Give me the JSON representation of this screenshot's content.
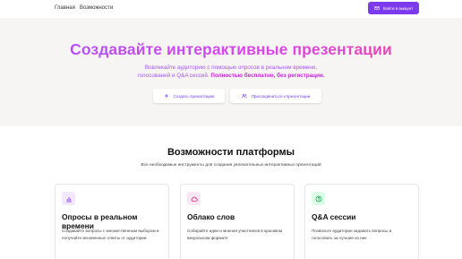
{
  "nav": {
    "home": "Главная",
    "features": "Возможности",
    "login": "Войти в аккаунт"
  },
  "hero": {
    "title": "Создавайте интерактивные презентации",
    "subtitle_line1": "Вовлекайте аудиторию с помощью опросов в реальном времени,",
    "subtitle_line2_normal": "голосований и Q&A сессий. ",
    "subtitle_line2_bold": "Полностью бесплатно, без регистрации.",
    "create_button": "Создать презентацию",
    "join_button": "Присоединиться к презентации"
  },
  "features": {
    "title": "Возможности платформы",
    "subtitle": "Все необходимые инструменты для создания увлекательных интерактивных презентаций",
    "cards": [
      {
        "icon": "bar-chart-icon",
        "title": "Опросы в реальном времени",
        "desc": "Создавайте вопросы с множественным выбором и получайте мгновенные ответы от аудитории",
        "icon_bg": "#f3e8ff",
        "icon_color": "#7c3aed"
      },
      {
        "icon": "cloud-icon",
        "title": "Облако слов",
        "desc": "Собирайте идеи и мнения участников в красивом визуальном формате",
        "icon_bg": "#fce7f3",
        "icon_color": "#db2777"
      },
      {
        "icon": "question-circle-icon",
        "title": "Q&A сессии",
        "desc": "Позвольте аудитории задавать вопросы и голосовать за лучшие из них",
        "icon_bg": "#dcfce7",
        "icon_color": "#16a34a"
      }
    ]
  },
  "colors": {
    "accent": "#7c3aed",
    "hero_bg": "#f7f5f3"
  }
}
